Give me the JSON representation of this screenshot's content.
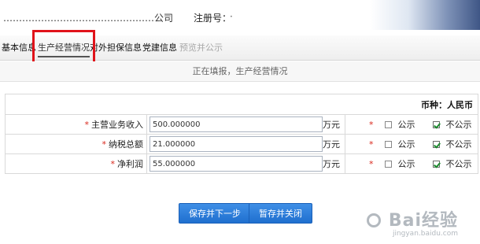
{
  "header": {
    "company_name": "…………………………………………公司",
    "reg_label": "注册号：",
    "reg_value": "·"
  },
  "tabs": [
    {
      "label": "基本信息",
      "state": "normal"
    },
    {
      "label": "生产经营情况",
      "state": "active"
    },
    {
      "label": "对外担保信息",
      "state": "normal"
    },
    {
      "label": "党建信息",
      "state": "normal"
    },
    {
      "label": "预览并公示",
      "state": "disabled"
    }
  ],
  "status_text": "正在填报，生产经营情况",
  "currency_label": "币种：人民币",
  "rows": [
    {
      "label": "主营业务收入",
      "value": "500.000000",
      "unit": "万元",
      "public_label": "公示",
      "public_checked": false,
      "private_label": "不公示",
      "private_checked": true
    },
    {
      "label": "纳税总额",
      "value": "21.000000",
      "unit": "万元",
      "public_label": "公示",
      "public_checked": false,
      "private_label": "不公示",
      "private_checked": true
    },
    {
      "label": "净利润",
      "value": "55.000000",
      "unit": "万元",
      "public_label": "公示",
      "public_checked": false,
      "private_label": "不公示",
      "private_checked": true
    }
  ],
  "required_mark": "*",
  "buttons": {
    "save_next": "保存并下一步",
    "save_close": "暂存并关闭"
  },
  "watermark": {
    "logo": "Bai经验",
    "url": "jingyan.baidu.com"
  },
  "colors": {
    "accent_button": "#2a7fdc",
    "required": "#d9271c",
    "highlight": "#e0131a"
  }
}
